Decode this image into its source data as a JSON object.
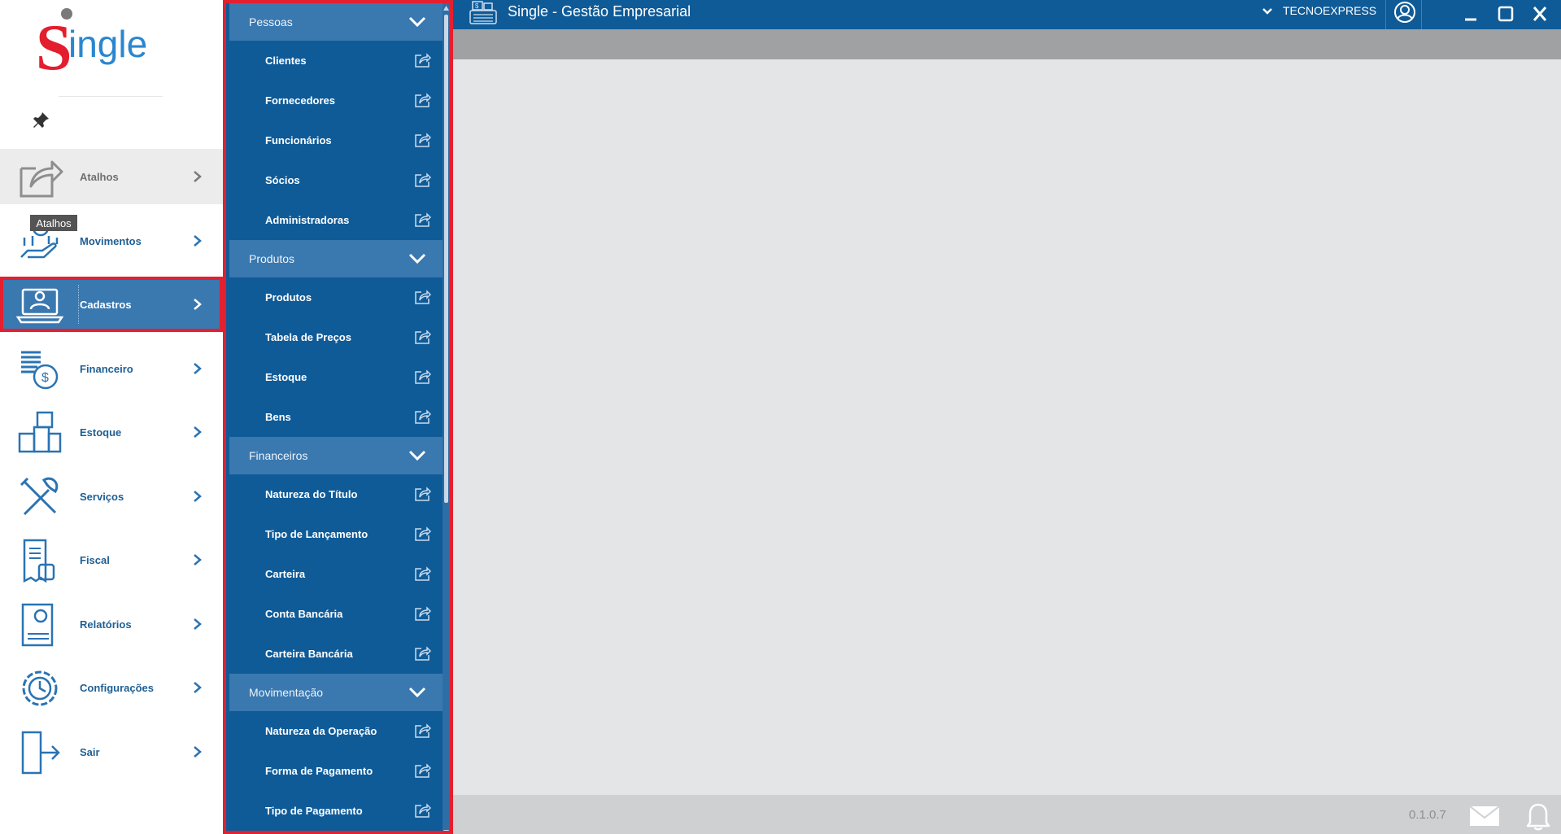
{
  "logo_text": "Single",
  "left_nav": {
    "items": [
      {
        "label": "Atalhos",
        "icon": "share-box-icon"
      },
      {
        "label": "Movimentos",
        "icon": "money-hand-icon"
      },
      {
        "label": "Cadastros",
        "icon": "laptop-user-icon"
      },
      {
        "label": "Financeiro",
        "icon": "coins-dollar-icon"
      },
      {
        "label": "Estoque",
        "icon": "boxes-icon"
      },
      {
        "label": "Serviços",
        "icon": "tools-icon"
      },
      {
        "label": "Fiscal",
        "icon": "receipt-icon"
      },
      {
        "label": "Relatórios",
        "icon": "report-icon"
      },
      {
        "label": "Configurações",
        "icon": "gear-clock-icon"
      },
      {
        "label": "Sair",
        "icon": "exit-door-icon"
      }
    ],
    "active": "Cadastros",
    "tooltip": "Atalhos"
  },
  "submenu": {
    "groups": [
      {
        "title": "Pessoas",
        "items": [
          "Clientes",
          "Fornecedores",
          "Funcionários",
          "Sócios",
          "Administradoras"
        ]
      },
      {
        "title": "Produtos",
        "items": [
          "Produtos",
          "Tabela de Preços",
          "Estoque",
          "Bens"
        ]
      },
      {
        "title": "Financeiros",
        "items": [
          "Natureza do Título",
          "Tipo de Lançamento",
          "Carteira",
          "Conta Bancária",
          "Carteira Bancária"
        ]
      },
      {
        "title": "Movimentação",
        "items": [
          "Natureza da Operação",
          "Forma de Pagamento",
          "Tipo de Pagamento"
        ]
      }
    ]
  },
  "titlebar": {
    "title": "Single - Gestão Empresarial",
    "company": "TECNOEXPRESS"
  },
  "status": {
    "version": "0.1.0.7"
  },
  "colors": {
    "brand_blue": "#0f5b98",
    "highlight_red": "#e22030",
    "logo_red": "#e31e2d",
    "logo_blue": "#2a87cf"
  }
}
